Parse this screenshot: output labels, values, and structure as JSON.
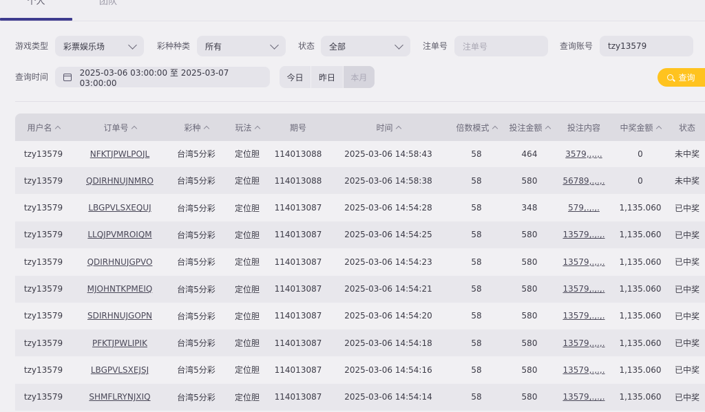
{
  "tabs": [
    {
      "label": "个人"
    },
    {
      "label": "团队"
    }
  ],
  "filters": {
    "game_type": {
      "label": "游戏类型",
      "value": "彩票娱乐场"
    },
    "lottery_type": {
      "label": "彩种种类",
      "value": "所有"
    },
    "status": {
      "label": "状态",
      "value": "全部"
    },
    "order_no": {
      "label": "注单号",
      "placeholder": "注单号"
    },
    "account": {
      "label": "查询账号",
      "value": "tzy13579"
    },
    "time": {
      "label": "查询时间",
      "value": "2025-03-06 03:00:00 至 2025-03-07 03:00:00"
    },
    "quick": [
      {
        "label": "今日"
      },
      {
        "label": "昨日"
      },
      {
        "label": "本月"
      }
    ],
    "query_button": "查询"
  },
  "table": {
    "headers": [
      "用户名",
      "订单号",
      "彩种",
      "玩法",
      "期号",
      "时间",
      "倍数模式",
      "投注金额",
      "投注内容",
      "中奖金额",
      "状态"
    ],
    "rows": [
      {
        "user": "tzy13579",
        "order": "NFKTJPWLPOJL",
        "lottery": "台湾5分彩",
        "play": "定位胆",
        "period": "114013088",
        "time": "2025-03-06 14:58:43",
        "multiple": "58",
        "amount": "464",
        "content": "3579,.,.,.",
        "prize": "0",
        "status": "未中奖"
      },
      {
        "user": "tzy13579",
        "order": "QDIRHNUJNMRO",
        "lottery": "台湾5分彩",
        "play": "定位胆",
        "period": "114013088",
        "time": "2025-03-06 14:58:38",
        "multiple": "58",
        "amount": "580",
        "content": "56789,.,.,.",
        "prize": "0",
        "status": "未中奖"
      },
      {
        "user": "tzy13579",
        "order": "LBGPVLSXEQUJ",
        "lottery": "台湾5分彩",
        "play": "定位胆",
        "period": "114013087",
        "time": "2025-03-06 14:54:28",
        "multiple": "58",
        "amount": "348",
        "content": "579,.,.,.",
        "prize": "1,135.060",
        "status": "已中奖"
      },
      {
        "user": "tzy13579",
        "order": "LLQJPVMROIQM",
        "lottery": "台湾5分彩",
        "play": "定位胆",
        "period": "114013087",
        "time": "2025-03-06 14:54:25",
        "multiple": "58",
        "amount": "580",
        "content": "13579,.,.,.",
        "prize": "1,135.060",
        "status": "已中奖"
      },
      {
        "user": "tzy13579",
        "order": "QDIRHNUJGPVO",
        "lottery": "台湾5分彩",
        "play": "定位胆",
        "period": "114013087",
        "time": "2025-03-06 14:54:23",
        "multiple": "58",
        "amount": "580",
        "content": "13579,.,.,.",
        "prize": "1,135.060",
        "status": "已中奖"
      },
      {
        "user": "tzy13579",
        "order": "MJOHNTKPMEIQ",
        "lottery": "台湾5分彩",
        "play": "定位胆",
        "period": "114013087",
        "time": "2025-03-06 14:54:21",
        "multiple": "58",
        "amount": "580",
        "content": "13579,.,.,.",
        "prize": "1,135.060",
        "status": "已中奖"
      },
      {
        "user": "tzy13579",
        "order": "SDIRHNUJGOPN",
        "lottery": "台湾5分彩",
        "play": "定位胆",
        "period": "114013087",
        "time": "2025-03-06 14:54:20",
        "multiple": "58",
        "amount": "580",
        "content": "13579,.,.,.",
        "prize": "1,135.060",
        "status": "已中奖"
      },
      {
        "user": "tzy13579",
        "order": "PFKTJPWLIPIK",
        "lottery": "台湾5分彩",
        "play": "定位胆",
        "period": "114013087",
        "time": "2025-03-06 14:54:18",
        "multiple": "58",
        "amount": "580",
        "content": "13579,.,.,.",
        "prize": "1,135.060",
        "status": "已中奖"
      },
      {
        "user": "tzy13579",
        "order": "LBGPVLSXEJSJ",
        "lottery": "台湾5分彩",
        "play": "定位胆",
        "period": "114013087",
        "time": "2025-03-06 14:54:16",
        "multiple": "58",
        "amount": "580",
        "content": "13579,.,.,.",
        "prize": "1,135.060",
        "status": "已中奖"
      },
      {
        "user": "tzy13579",
        "order": "SHMFLRYNJXIQ",
        "lottery": "台湾5分彩",
        "play": "定位胆",
        "period": "114013087",
        "time": "2025-03-06 14:54:14",
        "multiple": "58",
        "amount": "580",
        "content": "13579,.,.,.",
        "prize": "1,135.060",
        "status": "已中奖"
      }
    ]
  }
}
